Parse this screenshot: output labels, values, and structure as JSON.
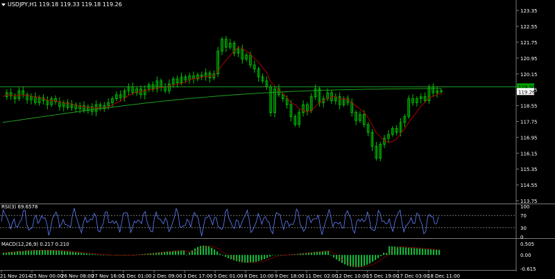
{
  "chart_data": [
    {
      "type": "candlestick",
      "title": "USDJPY,H1  119.18 119.33 119.18 119.26",
      "symbol": "USDJPY,H1",
      "ohlc": [
        119.18,
        119.33,
        119.18,
        119.26
      ],
      "ylim": [
        113.75,
        123.6
      ],
      "y_ticks": [
        "123.35",
        "122.55",
        "121.75",
        "120.95",
        "120.15",
        "119.35",
        "118.55",
        "117.75",
        "116.95",
        "116.15",
        "115.35",
        "114.55",
        "113.75"
      ],
      "current_price": "119.26",
      "hline_value": "119.50",
      "hline_label": "119.50",
      "close_series": [
        119.0,
        119.2,
        119.05,
        118.9,
        119.3,
        119.1,
        118.85,
        119.0,
        118.7,
        118.95,
        118.8,
        118.6,
        118.9,
        118.75,
        118.5,
        118.7,
        118.45,
        118.6,
        118.4,
        118.55,
        118.3,
        118.5,
        118.25,
        118.6,
        118.4,
        118.55,
        118.7,
        118.9,
        119.1,
        118.95,
        119.3,
        119.5,
        119.2,
        119.4,
        119.1,
        119.35,
        119.6,
        119.4,
        119.8,
        119.5,
        119.3,
        119.65,
        119.9,
        119.7,
        120.0,
        119.85,
        120.05,
        119.9,
        120.1,
        120.0,
        120.2,
        119.95,
        120.15,
        121.3,
        121.9,
        121.5,
        121.7,
        121.2,
        121.4,
        120.9,
        121.1,
        120.6,
        120.4,
        120.0,
        119.8,
        119.5,
        118.2,
        119.4,
        119.1,
        118.9,
        118.6,
        118.0,
        117.6,
        118.2,
        118.6,
        118.3,
        119.0,
        119.4,
        118.7,
        118.9,
        119.2,
        118.8,
        119.0,
        118.6,
        118.9,
        118.7,
        118.2,
        117.8,
        118.1,
        117.6,
        117.2,
        116.5,
        115.9,
        116.6,
        116.9,
        117.1,
        117.4,
        117.2,
        117.7,
        118.0,
        118.9,
        118.7,
        118.9,
        119.0,
        118.8,
        119.5,
        119.2,
        119.3,
        119.26
      ],
      "ma_fast": "dark-red",
      "ma_slow": "green",
      "x_ticks": [
        "21 Nov 2014",
        "25 Nov 00:00",
        "26 Nov 08:00",
        "27 Nov 16:00",
        "1 Dec 01:00",
        "2 Dec 09:00",
        "3 Dec 17:00",
        "5 Dec 01:00",
        "8 Dec 10:00",
        "9 Dec 18:00",
        "11 Dec 02:00",
        "12 Dec 10:00",
        "15 Dec 19:00",
        "17 Dec 03:00",
        "18 Dec 11:00"
      ]
    },
    {
      "type": "line",
      "title": "RSI(3) 69.6578",
      "ylim": [
        0,
        100
      ],
      "y_ticks": [
        "100",
        "70",
        "30",
        "0"
      ],
      "levels": [
        70,
        30
      ],
      "color": "#5a78ff"
    },
    {
      "type": "bar",
      "title": "MACD(12,26,9) 0.217 0.210",
      "ylim": [
        -0.615,
        0.505
      ],
      "y_ticks": [
        "0.505",
        "0.00",
        "-0.615"
      ],
      "color": "#0fb43c"
    }
  ],
  "colors": {
    "background": "#000000",
    "axis": "#7a7a7a",
    "candle": "#00c800",
    "ma_fast": "#b00000",
    "ma_slow": "#1ea01e",
    "rsi": "#6482ff",
    "macd_bars": "#14b43c",
    "macd_signal": "#c80000",
    "price_label_bg": "#ffffff",
    "hline_label_bg": "#00a000"
  }
}
